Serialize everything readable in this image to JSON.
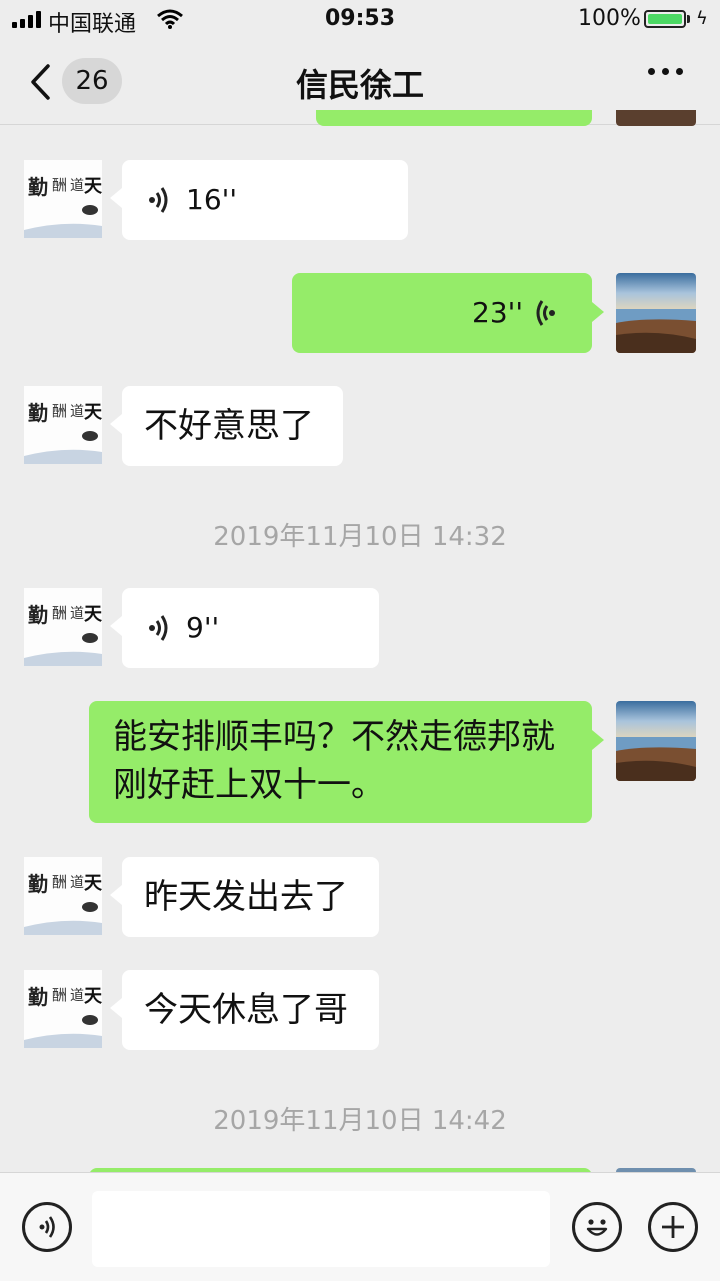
{
  "status_bar": {
    "carrier": "中国联通",
    "time": "09:53",
    "battery": "100%"
  },
  "nav": {
    "unread_count": "26",
    "title": "信民徐工"
  },
  "messages": [
    {
      "type": "voice",
      "side": "in",
      "duration": "16''"
    },
    {
      "type": "voice",
      "side": "out",
      "duration": "23''"
    },
    {
      "type": "text",
      "side": "in",
      "text": "不好意思了"
    },
    {
      "type": "timestamp",
      "text": "2019年11月10日 14:32"
    },
    {
      "type": "voice",
      "side": "in",
      "duration": "9''"
    },
    {
      "type": "text",
      "side": "out",
      "lines": [
        "能安排顺丰吗？不然走德邦就",
        "刚好赶上双十一。"
      ]
    },
    {
      "type": "text",
      "side": "in",
      "text": "昨天发出去了"
    },
    {
      "type": "text",
      "side": "in",
      "text": "今天休息了哥"
    },
    {
      "type": "timestamp",
      "text": "2019年11月10日 14:42"
    }
  ],
  "input_bar": {
    "text_value": ""
  },
  "colors": {
    "outgoing_bubble": "#95ec69",
    "incoming_bubble": "#ffffff",
    "background": "#ededed"
  }
}
